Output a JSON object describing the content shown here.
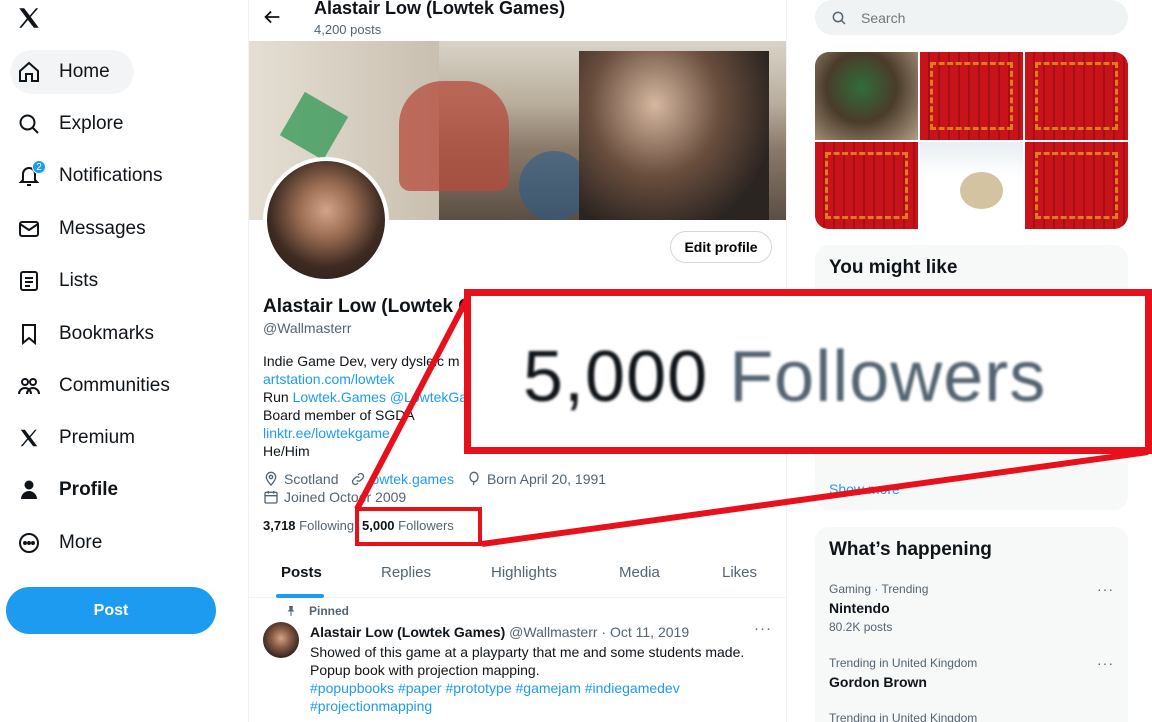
{
  "nav": {
    "items": [
      {
        "label": "Home"
      },
      {
        "label": "Explore"
      },
      {
        "label": "Notifications",
        "badge": "2"
      },
      {
        "label": "Messages"
      },
      {
        "label": "Lists"
      },
      {
        "label": "Bookmarks"
      },
      {
        "label": "Communities"
      },
      {
        "label": "Premium"
      },
      {
        "label": "Profile"
      },
      {
        "label": "More"
      }
    ],
    "post_label": "Post"
  },
  "header": {
    "name": "Alastair Low (Lowtek Games)",
    "post_count": "4,200 posts"
  },
  "profile": {
    "edit_label": "Edit profile",
    "name": "Alastair Low (Lowtek G",
    "handle": "@Wallmasterr",
    "bio": {
      "line1": "Indie Game Dev, very dysle",
      "line1_tail": "ic m",
      "link1": "artstation.com/lowtek",
      "run_prefix": "Run ",
      "run_link1": "Lowtek.Games",
      "run_link2": "@LowtekGam",
      "line4": "Board member of SGDA",
      "link2": "linktr.ee/lowtekgame",
      "pronouns": "He/Him"
    },
    "location": "Scotland",
    "website": "owtek.games",
    "born": "Born April 20, 1991",
    "joined": "Joined Octo",
    "joined_tail": "er 2009",
    "following_count": "3,718",
    "following_label": "Following",
    "followers_count": "5,000",
    "followers_label": "Followers"
  },
  "tabs": [
    {
      "label": "Posts"
    },
    {
      "label": "Replies"
    },
    {
      "label": "Highlights"
    },
    {
      "label": "Media"
    },
    {
      "label": "Likes"
    }
  ],
  "pinned_post": {
    "pinned_label": "Pinned",
    "name": "Alastair Low (Lowtek Games)",
    "meta": "@Wallmasterr · Oct 11, 2019",
    "more": "···",
    "line1": "Showed of this game at a playparty that me and some students made.",
    "line2": "Popup book with projection mapping.",
    "hashtags1": "#popupbooks #paper #prototype #gamejam #indiegamedev",
    "hashtags2": "#projectionmapping"
  },
  "search": {
    "placeholder": "Search"
  },
  "you_might_like": {
    "title": "You might like",
    "show_more": "Show more"
  },
  "whats_happening": {
    "title": "What’s happening",
    "trends": [
      {
        "meta": "Gaming · Trending",
        "name": "Nintendo",
        "count": "80.2K posts"
      },
      {
        "meta": "Trending in United Kingdom",
        "name": "Gordon Brown",
        "count": ""
      },
      {
        "meta": "Trending in United Kingdom",
        "name": "",
        "count": ""
      }
    ]
  },
  "zoom_callout": {
    "count": "5,000",
    "label": "Followers"
  },
  "colors": {
    "accent": "#1d9bf0",
    "highlight_red": "#e8101a",
    "muted_text": "#536471"
  }
}
